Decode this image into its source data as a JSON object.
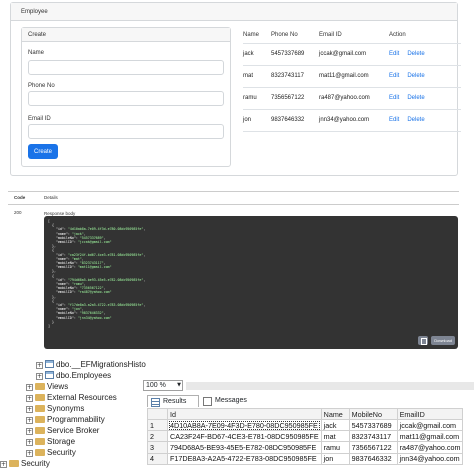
{
  "employee_app": {
    "card_title": "Employee",
    "create": {
      "title": "Create",
      "fields": [
        {
          "label": "Name",
          "value": ""
        },
        {
          "label": "Phone No",
          "value": ""
        },
        {
          "label": "Email ID",
          "value": ""
        }
      ],
      "button": "Create"
    },
    "table": {
      "headers": [
        "Name",
        "Phone No",
        "Email ID",
        "Action"
      ],
      "edit_label": "Edit",
      "delete_label": "Delete",
      "rows": [
        {
          "name": "jack",
          "phone": "5457337689",
          "email": "jccak@gmail.com"
        },
        {
          "name": "mat",
          "phone": "8323743117",
          "email": "mat11@gmail.com"
        },
        {
          "name": "ramu",
          "phone": "7356567122",
          "email": "ra487@yahoo.com"
        },
        {
          "name": "jon",
          "phone": "9837646332",
          "email": "jnn34@yahoo.com"
        }
      ]
    }
  },
  "swagger": {
    "col_code": "Code",
    "col_details": "Details",
    "status_code": "200",
    "response_body_label": "Response body",
    "body_records": [
      {
        "id": "4d10ab8a-7e09-4f3d-e780-08dc950985fe",
        "name": "jack",
        "mobileNo": "5457337689",
        "emailID": "jccak@gmail.com"
      },
      {
        "id": "ca23f24f-bd67-4ce3-e781-08dc950985fe",
        "name": "mat",
        "mobileNo": "8323743117",
        "emailID": "mat11@gmail.com"
      },
      {
        "id": "794d68a5-be93-45e5-e782-08dc950985fe",
        "name": "ramu",
        "mobileNo": "7356567122",
        "emailID": "ra487@yahoo.com"
      },
      {
        "id": "f17de8a3-a2a5-4722-e783-08dc950985fe",
        "name": "jon",
        "mobileNo": "9837646332",
        "emailID": "jnn34@yahoo.com"
      }
    ],
    "download_label": "Download"
  },
  "ssms": {
    "tree": [
      {
        "label": "dbo.__EFMigrationsHisto",
        "kind": "table"
      },
      {
        "label": "dbo.Employees",
        "kind": "table"
      },
      {
        "label": "Views",
        "kind": "folder"
      },
      {
        "label": "External Resources",
        "kind": "folder"
      },
      {
        "label": "Synonyms",
        "kind": "folder"
      },
      {
        "label": "Programmability",
        "kind": "folder"
      },
      {
        "label": "Service Broker",
        "kind": "folder"
      },
      {
        "label": "Storage",
        "kind": "folder"
      },
      {
        "label": "Security",
        "kind": "folder"
      },
      {
        "label": "Security",
        "kind": "folder"
      }
    ],
    "zoom": "100 %",
    "tab_results": "Results",
    "tab_messages": "Messages",
    "grid": {
      "headers": [
        "",
        "Id",
        "Name",
        "MobileNo",
        "EmailID"
      ],
      "rows": [
        {
          "n": "1",
          "id": "4D10AB8A-7E09-4F3D-E780-08DC950985FE",
          "name": "jack",
          "mobile": "5457337689",
          "email": "jccak@gmail.com"
        },
        {
          "n": "2",
          "id": "CA23F24F-BD67-4CE3-E781-08DC950985FE",
          "name": "mat",
          "mobile": "8323743117",
          "email": "mat11@gmail.com"
        },
        {
          "n": "3",
          "id": "794D68A5-BE93-45E5-E782-08DC950985FE",
          "name": "ramu",
          "mobile": "7356567122",
          "email": "ra487@yahoo.com"
        },
        {
          "n": "4",
          "id": "F17DE8A3-A2A5-4722-E783-08DC950985FE",
          "name": "jon",
          "mobile": "9837646332",
          "email": "jnn34@yahoo.com"
        }
      ]
    }
  },
  "colors": {
    "primary": "#1a73e8",
    "code_bg": "#333333",
    "string_green": "#a2fca2",
    "folder": "#dcb35c"
  }
}
